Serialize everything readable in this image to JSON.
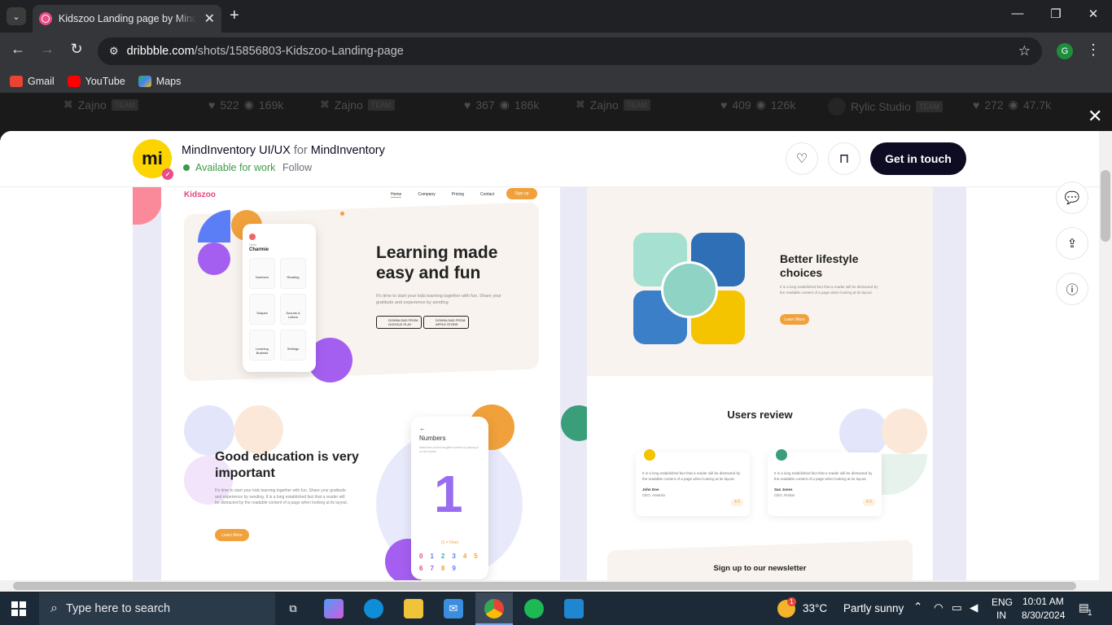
{
  "browser": {
    "tab_title": "Kidszoo Landing page by MindInventory UI/UX for MindInventory on Dribbble",
    "url_domain": "dribbble.com",
    "url_path": "/shots/15856803-Kidszoo-Landing-page",
    "profile_initial": "G",
    "bookmarks": [
      {
        "label": "Gmail",
        "icon": "gmail-icon",
        "color": "#ea4335"
      },
      {
        "label": "YouTube",
        "icon": "youtube-icon",
        "color": "#ff0000"
      },
      {
        "label": "Maps",
        "icon": "maps-icon",
        "color": "#34a853"
      }
    ]
  },
  "background_strip": [
    {
      "author": "Zajno",
      "badge": "TEAM",
      "likes": "522",
      "views": "169k"
    },
    {
      "author": "Zajno",
      "badge": "TEAM",
      "likes": "367",
      "views": "186k"
    },
    {
      "author": "Zajno",
      "badge": "TEAM",
      "likes": "409",
      "views": "126k"
    },
    {
      "author": "Rylic Studio",
      "badge": "TEAM",
      "likes": "272",
      "views": "47.7k"
    }
  ],
  "modal": {
    "author_name": "MindInventory UI/UX",
    "for_text": "for",
    "team_name": "MindInventory",
    "avatar_text": "mi",
    "availability": "Available for work",
    "follow_label": "Follow",
    "cta_label": "Get in touch"
  },
  "shot": {
    "logo": "Kidszoo",
    "nav": [
      "Home",
      "Company",
      "Pricing",
      "Contact"
    ],
    "signup": "Sign up",
    "hero_title": "Learning made easy and fun",
    "hero_sub": "It's time to start your kids learning together with fun. Share your gratitude and experience by sending",
    "google_play": "DOWNLOAD FROM GOOGLE PLAY",
    "app_store": "DOWNLOAD FROM APPLE STORE",
    "phone_hello": "Hello",
    "phone_name": "Charmie",
    "phone_cards": [
      "Numbers",
      "Reading",
      "Shapes",
      "Sounds & Letters",
      "Learning Brainsts",
      "Settings"
    ],
    "edu_title": "Good education is very important",
    "edu_text": "It's time to start your kids learning together with fun. Share your gratitude and experience by sending. It is a long established fact that a reader will be distracted by the readable content of a page when looking at its layout.",
    "learn_more": "Learn More",
    "numbers_title": "Numbers",
    "numbers_sub": "Match the correct tangible number by placing it on the screen",
    "number_one": "(1 = One)",
    "digits": [
      "0",
      "1",
      "2",
      "3",
      "4",
      "5",
      "6",
      "7",
      "8",
      "9"
    ],
    "lifestyle_title": "Better lifestyle choices",
    "lifestyle_text": "It is a long established fact that a reader will be distracted by the readable content of a page when looking at its layout.",
    "reviews_title": "Users review",
    "reviews": [
      {
        "text": "It is a long established fact that a reader will be distracted by the readable content of a page when looking at its layout.",
        "name": "John Doe",
        "role": "CEO, Antarria",
        "rating": "4.5"
      },
      {
        "text": "It is a long established fact that a reader will be distracted by the readable content of a page when looking at its layout.",
        "name": "San Jones",
        "role": "CEO, Rodus",
        "rating": "4.5"
      }
    ],
    "newsletter": "Sign up to our newsletter"
  },
  "taskbar": {
    "search_placeholder": "Type here to search",
    "weather_temp": "33°C",
    "weather_desc": "Partly sunny",
    "lang": "ENG",
    "region": "IN",
    "time": "10:01 AM",
    "date": "8/30/2024",
    "notification_count": "1",
    "weather_badge": "1"
  }
}
